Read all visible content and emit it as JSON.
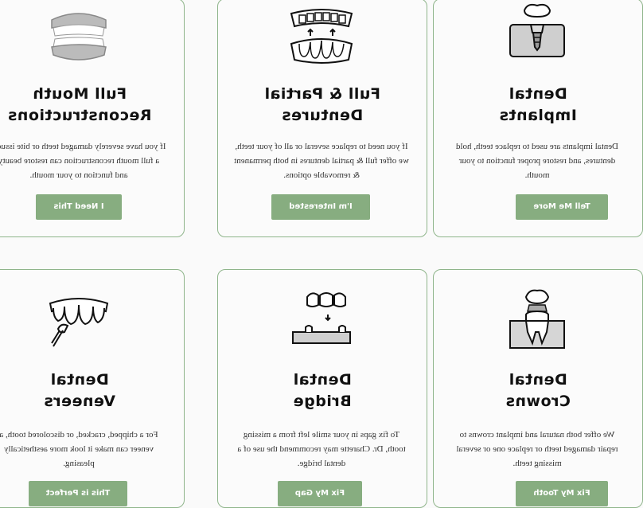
{
  "services": [
    {
      "title_line1": "Dental",
      "title_line2": "Implants",
      "icon": "dental-implant-icon",
      "description": "Dental implants are used to replace teeth, hold dentures, and restore proper function to your mouth.",
      "button": "Tell Me More"
    },
    {
      "title_line1": "Full & Partial",
      "title_line2": "Dentures",
      "icon": "dentures-icon",
      "description": "If you need to replace several or all of your teeth, we offer full & partial dentures in both permanent & removable options.",
      "button": "I'm Interested"
    },
    {
      "title_line1": "Full Mouth",
      "title_line2": "Reconstructions",
      "icon": "full-mouth-icon",
      "description": "If you have severely damaged teeth or bite issues, a full mouth reconstruction can restore beauty and function to your mouth.",
      "button": "I Need This"
    },
    {
      "title_line1": "Dental",
      "title_line2": "Crowns",
      "icon": "dental-crown-icon",
      "description": "We offer both natural and implant crowns to repair damaged teeth or replace one or several missing teeth.",
      "button": "Fix My Tooth"
    },
    {
      "title_line1": "Dental",
      "title_line2": "Bridge",
      "icon": "dental-bridge-icon",
      "description": "To fix gaps in your smile left from a missing tooth, Dr. Charette may recommend the use of a dental bridge.",
      "button": "Fix My Gap"
    },
    {
      "title_line1": "Dental",
      "title_line2": "Veneers",
      "icon": "veneers-icon",
      "description": "For a chipped, cracked, or discolored tooth, a veneer can make it look more aesthetically pleasing.",
      "button": "This is Perfect"
    }
  ],
  "colors": {
    "accent": "#87ad80",
    "border": "#8fb58b"
  }
}
